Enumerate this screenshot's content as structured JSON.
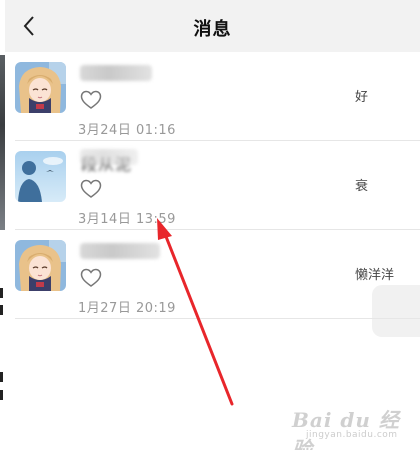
{
  "header": {
    "title": "消息",
    "back_icon": "chevron-left-icon"
  },
  "messages": [
    {
      "avatar": "anime-girl-avatar",
      "name": "",
      "like_icon": "heart-outline-icon",
      "time": "3月24日 01:16",
      "right_text": "好"
    },
    {
      "avatar": "silhouette-avatar",
      "name": "段从泥",
      "like_icon": "heart-outline-icon",
      "time": "3月14日 13:59",
      "right_text": "衰"
    },
    {
      "avatar": "anime-girl-avatar",
      "name": "",
      "like_icon": "heart-outline-icon",
      "time": "1月27日 20:19",
      "right_text": "懒洋洋"
    }
  ],
  "annotation": {
    "color": "#e8262b"
  },
  "watermark": {
    "main": "Bai du 经验",
    "sub": "jingyan.baidu.com"
  }
}
